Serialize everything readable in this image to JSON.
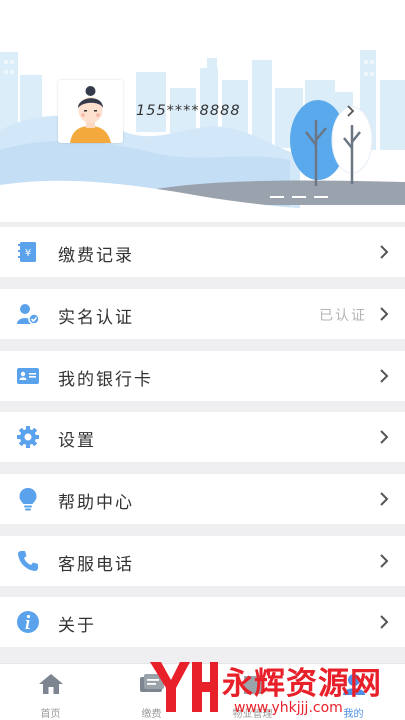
{
  "profile": {
    "phone": "155****8888"
  },
  "menu": [
    {
      "label": "缴费记录",
      "status": ""
    },
    {
      "label": "实名认证",
      "status": "已认证"
    },
    {
      "label": "我的银行卡",
      "status": ""
    },
    {
      "label": "设置",
      "status": ""
    },
    {
      "label": "帮助中心",
      "status": ""
    },
    {
      "label": "客服电话",
      "status": ""
    },
    {
      "label": "关于",
      "status": ""
    }
  ],
  "tabs": [
    {
      "label": "首页",
      "icon": "home-icon"
    },
    {
      "label": "缴费",
      "icon": "payment-icon"
    },
    {
      "label": "物业管理",
      "icon": "property-icon"
    },
    {
      "label": "我的",
      "icon": "user-icon"
    }
  ],
  "watermark": {
    "text": "永辉资源网",
    "url": "www.yhkjjj.com"
  },
  "colors": {
    "accent": "#4d90e8",
    "icon_blue": "#5aa2ec",
    "watermark_red": "#e8202a"
  }
}
